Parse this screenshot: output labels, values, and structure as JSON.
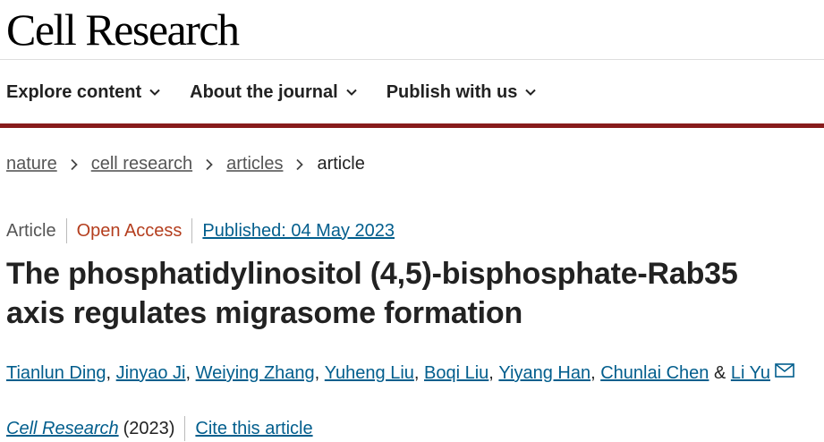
{
  "site": {
    "brand": "Cell Research"
  },
  "nav": {
    "items": [
      {
        "label": "Explore content"
      },
      {
        "label": "About the journal"
      },
      {
        "label": "Publish with us"
      }
    ]
  },
  "breadcrumb": {
    "links": [
      "nature",
      "cell research",
      "articles"
    ],
    "current": "article"
  },
  "article": {
    "type": "Article",
    "access": "Open Access",
    "published": "Published: 04 May 2023",
    "title_line1": "The phosphatidylinositol (4,5)-bisphosphate-Rab35",
    "title_line2": "axis regulates migrasome formation",
    "authors": [
      "Tianlun Ding",
      "Jinyao Ji",
      "Weiying Zhang",
      "Yuheng Liu",
      "Boqi Liu",
      "Yiyang Han",
      "Chunlai Chen",
      "Li Yu"
    ],
    "separator": ", ",
    "last_separator": " & ",
    "journal": "Cell Research",
    "year": "(2023)",
    "cite_label": "Cite this article"
  },
  "colors": {
    "brand_bar": "#881c1c",
    "link": "#025e8d",
    "open_access": "#b43e1e"
  },
  "icons": {
    "nav_chevron": "chevron-down-icon",
    "breadcrumb_sep": "chevron-right-icon",
    "corresponding_author": "envelope-icon"
  }
}
